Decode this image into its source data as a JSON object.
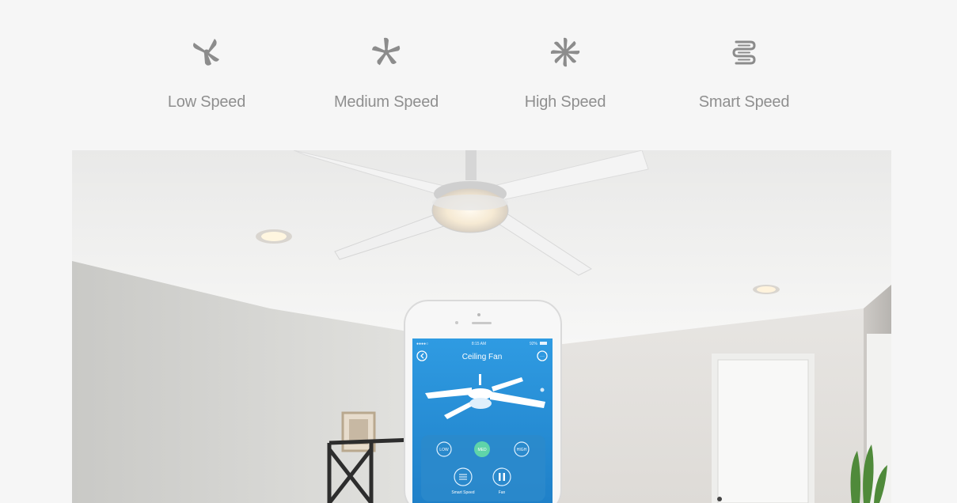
{
  "speed_modes": [
    {
      "label": "Low Speed",
      "icon": "fan-low-icon"
    },
    {
      "label": "Medium Speed",
      "icon": "fan-medium-icon"
    },
    {
      "label": "High Speed",
      "icon": "fan-high-icon"
    },
    {
      "label": "Smart Speed",
      "icon": "smart-speed-icon"
    }
  ],
  "phone_app": {
    "status_time": "8:15 AM",
    "status_battery": "92%",
    "title": "Ceiling Fan",
    "buttons": {
      "low": "LOW",
      "med": "MED",
      "high": "HIGH",
      "smart_speed": "Smart Speed",
      "fan": "Fan"
    },
    "selected_speed": "MED"
  },
  "colors": {
    "page_background": "#f6f6f6",
    "label_gray": "#8f8f8f",
    "icon_gray": "#8c8c8c",
    "app_blue": "#2b93dc",
    "selected_green": "#5fd4a9"
  }
}
